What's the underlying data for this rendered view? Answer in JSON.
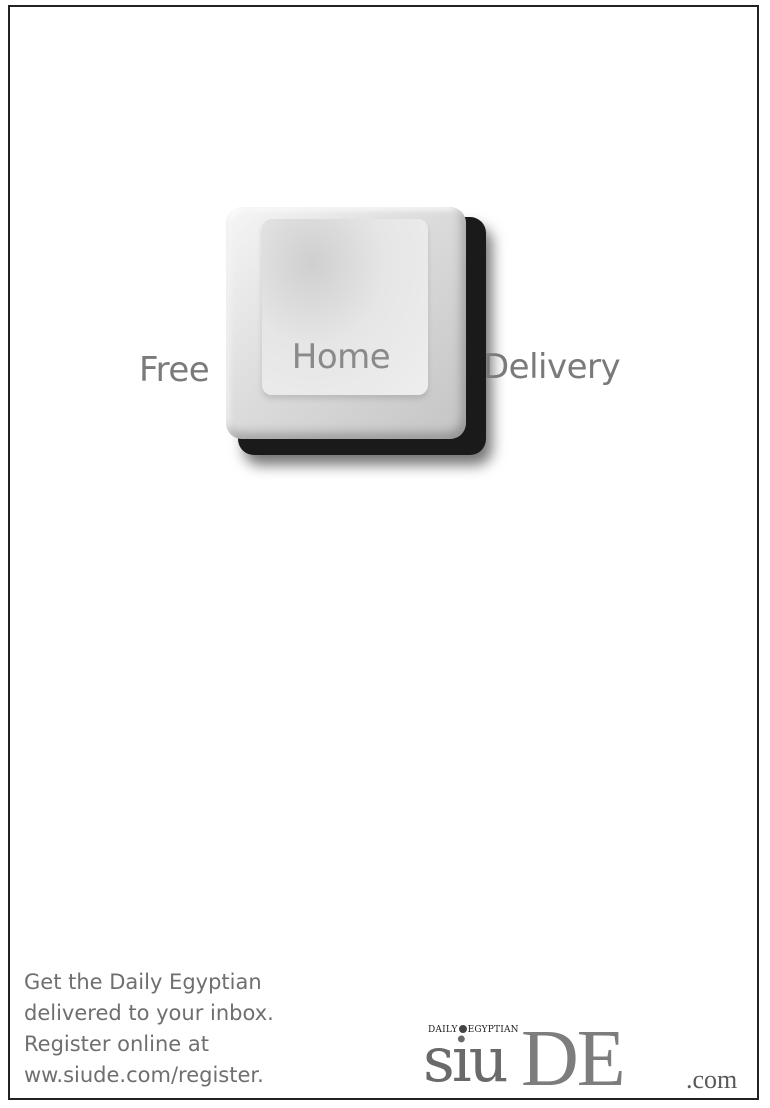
{
  "headline": {
    "free": "Free",
    "key_label": "Home",
    "delivery": "Delivery"
  },
  "footer": {
    "lines": [
      "Get the Daily Egyptian",
      "delivered to your inbox.",
      "Register online at",
      "ww.siude.com/register."
    ]
  },
  "logo": {
    "tag_left": "DAILY",
    "tag_right": "EGYPTIAN",
    "siu": "siu",
    "de": "DE",
    "com": ".com"
  },
  "colors": {
    "text_gray": "#7a7a7a",
    "key_shadow": "#1a1a1a",
    "border": "#222222"
  }
}
